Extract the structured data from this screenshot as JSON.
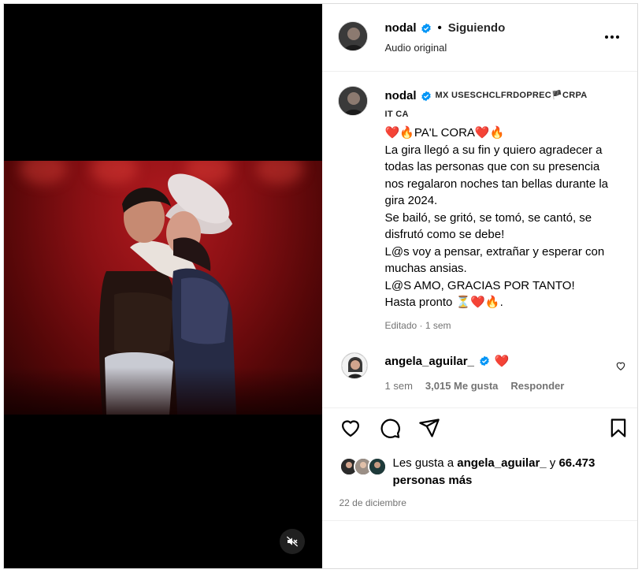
{
  "header": {
    "username": "nodal",
    "separator": "•",
    "following_label": "Siguiendo",
    "audio_label": "Audio original"
  },
  "caption": {
    "username": "nodal",
    "bio_line1": "MX USESCHCLFRDOPREC🏴CRPA",
    "bio_line2": "IT CA",
    "text": "❤️🔥PA'L CORA❤️🔥\nLa gira llegó a su fin y quiero agradecer a todas las personas que con su presencia nos regalaron noches tan bellas durante la gira 2024.\nSe bailó, se gritó, se tomó, se cantó, se disfrutó como se debe!\nL@s voy a pensar, extrañar y esperar con muchas ansias.\nL@S AMO, GRACIAS POR TANTO!\nHasta pronto ⏳❤️🔥.",
    "meta": "Editado · 1 sem"
  },
  "comment": {
    "username": "angela_aguilar_",
    "text": "❤️",
    "time": "1 sem",
    "likes": "3,015 Me gusta",
    "reply_label": "Responder"
  },
  "likes": {
    "prefix": "Les gusta a",
    "user": "angela_aguilar_",
    "connector": "y",
    "count": "66.473",
    "suffix": "personas más"
  },
  "date": "22 de diciembre",
  "colors": {
    "verified": "#0095f6",
    "muted_text": "#737373",
    "border": "#dbdbdb"
  },
  "icons": {
    "more": "more-icon",
    "mute": "mute-icon",
    "like": "heart-icon",
    "comment": "comment-icon",
    "share": "send-icon",
    "save": "bookmark-icon"
  }
}
